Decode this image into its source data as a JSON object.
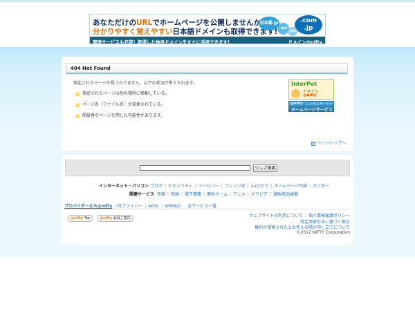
{
  "banner": {
    "line1_pre": "あなただけの",
    "line1_url": "URL",
    "line1_post": "でホームページを公開しませんか？",
    "line2_hl": "分かりやすく覚えやすい",
    "line2_post": "日本語ドメインも取得できます!",
    "strip_left": "関連サービスも充実！取得した独自ドメインをすぐに活用できます！",
    "strip_right": "ドメイン@nifty",
    "bubble_jp": "日本語.jp",
    "bubble_com": ".com",
    "bubble_jp2": ".jp",
    "bubble_net": ".net",
    "bubble_biz": ".biz"
  },
  "main": {
    "title": "404 Not Found",
    "intro": "指定されたページが見つかりません。以下の状況が考えられます。",
    "reasons": [
      "指定されたページは別の場所に移動している。",
      "ページ名（ファイル名）が変更されている。",
      "開設者がページを閉じた可能性があります。"
    ],
    "ad1": {
      "title": "InterPot",
      "line1": "ドメイン",
      "line2": "@nifty"
    },
    "ad2": {
      "brand": "@nifty",
      "sub": "レンタルサーバー",
      "line": "ホームページサービス"
    },
    "page_top": "ページトップへ"
  },
  "search": {
    "value": "",
    "button": "ウェブ検索"
  },
  "footer": {
    "row1_label": "インターネット・パソコン",
    "row1_links": [
      "ブログ",
      "セキュリティ",
      "ツールバー",
      "フレッツ光",
      "auひかり",
      "ホームページ作成",
      "アバター"
    ],
    "row2_label": "関連サービス",
    "row2_links": [
      "音楽",
      "映画",
      "電子書籍",
      "無料ゲーム",
      "アニメ",
      "グラビア",
      "通販商品検索"
    ],
    "provider_label": "プロバイダーなら@nifty",
    "provider_links": [
      "光ファイバー",
      "ADSL",
      "WiMAX",
      "全サービス一覧"
    ],
    "logo1_brand": "@nifty",
    "logo1_text": "Top",
    "logo2_brand": "@nifty",
    "logo2_text": "会員ご案内",
    "link_privacy": "ウェブサイトの利用について",
    "link_privacy2": "個人情報保護ポリシー",
    "link_law": "特定商取引法に基づく表示",
    "link_rights": "権利が侵害されたとお考えの際の申し立てについて",
    "copyright": "©2012 NIFTY Corporation"
  }
}
